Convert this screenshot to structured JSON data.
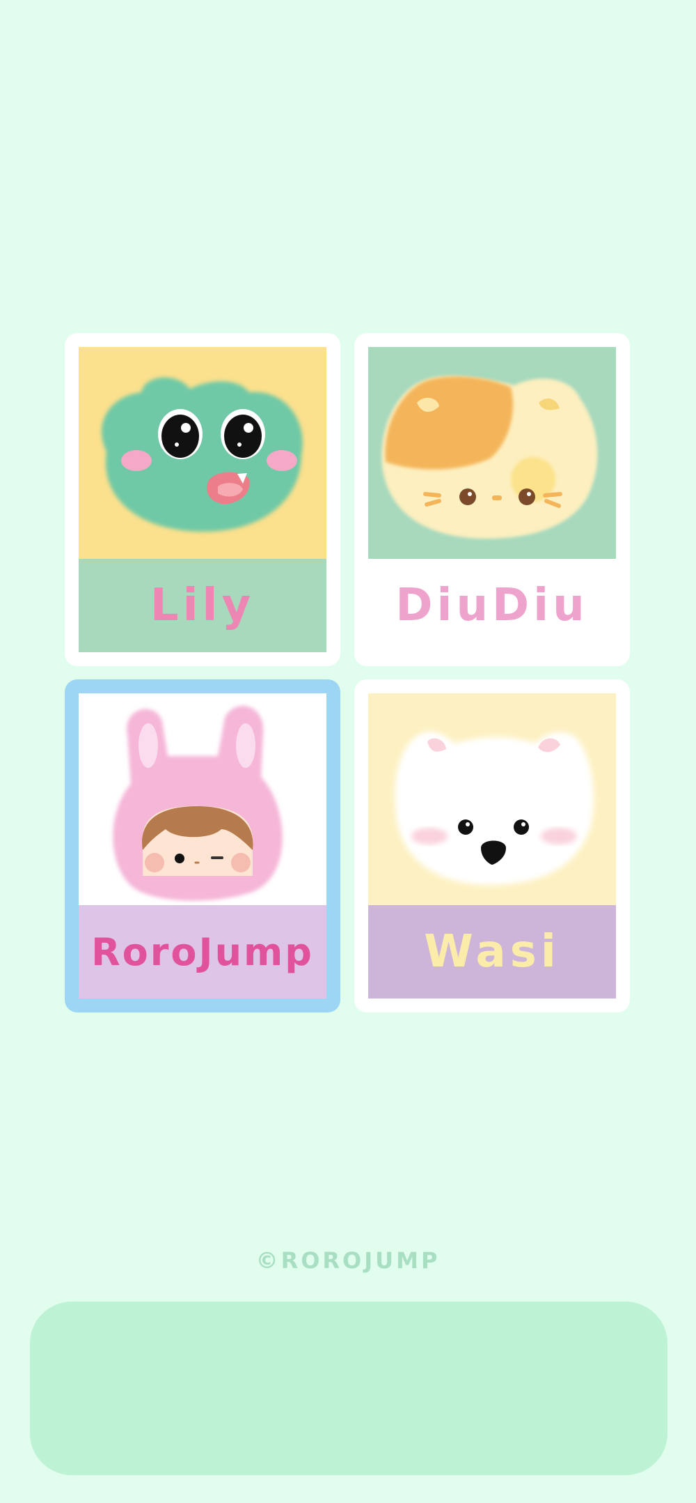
{
  "characters": [
    {
      "name": "Lily",
      "art_color": "#fbe08d",
      "band_color": "#a7d9bd",
      "label_color": "#ee86b4"
    },
    {
      "name": "DiuDiu",
      "art_color": "#a7d9bd",
      "band_color": "#ffffff",
      "label_color": "#eea3cd"
    },
    {
      "name": "RoroJump",
      "art_color": "#ffffff",
      "band_color": "#dec4e6",
      "label_color": "#e0539a",
      "selected": true
    },
    {
      "name": "Wasi",
      "art_color": "#fdf1c3",
      "band_color": "#cdb5da",
      "label_color": "#fbecaa"
    }
  ],
  "footer": {
    "copyright": "©ROROJUMP"
  },
  "colors": {
    "background": "#e1fdee",
    "selection_border": "#9cd6f4",
    "bottom_panel": "#bdf2d5"
  }
}
